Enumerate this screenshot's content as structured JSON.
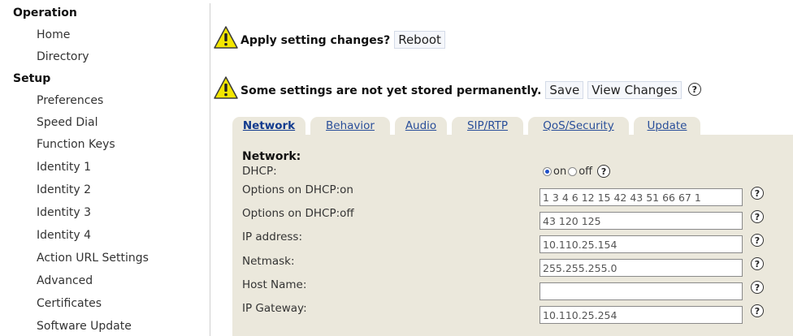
{
  "sidebar": {
    "sections": [
      {
        "title": "Operation",
        "items": [
          "Home",
          "Directory"
        ]
      },
      {
        "title": "Setup",
        "items": [
          "Preferences",
          "Speed Dial",
          "Function Keys",
          "Identity 1",
          "Identity 2",
          "Identity 3",
          "Identity 4",
          "Action URL Settings",
          "Advanced",
          "Certificates",
          "Software Update"
        ]
      }
    ]
  },
  "messages": {
    "apply": {
      "text": "Apply setting changes?",
      "button": "Reboot"
    },
    "store": {
      "text": "Some settings are not yet stored permanently.",
      "save": "Save",
      "view": "View Changes"
    }
  },
  "help_glyph": "?",
  "tabs": [
    {
      "label": "Network",
      "active": true
    },
    {
      "label": "Behavior",
      "active": false
    },
    {
      "label": "Audio",
      "active": false
    },
    {
      "label": "SIP/RTP",
      "active": false
    },
    {
      "label": "QoS/Security",
      "active": false
    },
    {
      "label": "Update",
      "active": false
    }
  ],
  "form": {
    "title": "Network:",
    "dhcp": {
      "label": "DHCP:",
      "on_label": "on",
      "off_label": "off",
      "selected": "on"
    },
    "fields": [
      {
        "label": "Options on DHCP:on",
        "value": "1 3 4 6 12 15 42 43 51 66 67 1"
      },
      {
        "label": "Options on DHCP:off",
        "value": "43 120 125"
      },
      {
        "label": "IP address:",
        "value": "10.110.25.154"
      },
      {
        "label": "Netmask:",
        "value": "255.255.255.0"
      },
      {
        "label": "Host Name:",
        "value": ""
      },
      {
        "label": "IP Gateway:",
        "value": "10.110.25.254"
      }
    ]
  },
  "colors": {
    "panel": "#ebe8dc",
    "tab_link": "#2a4f9a",
    "warning": "#f2e600"
  }
}
